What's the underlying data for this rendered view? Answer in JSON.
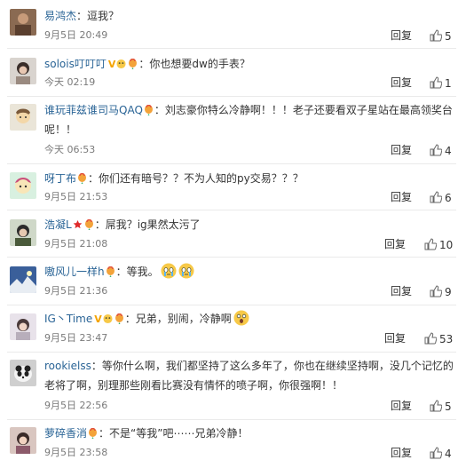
{
  "comments": [
    {
      "user": "易鸿杰",
      "sep": "：",
      "text": "逗我？",
      "time": "9月5日 20:49",
      "reply": "回复",
      "likes": "5"
    },
    {
      "user": "solois叮叮叮",
      "vip": "V",
      "sep": "：",
      "text": "你也想要dw的手表？",
      "time": "今天 02:19",
      "reply": "回复",
      "likes": "1"
    },
    {
      "user": "谁玩菲兹谁司马QAQ",
      "sep": "：",
      "text": "刘志豪你特么冷静啊！！！老子还要看双子星站在最高领奖台呢！！",
      "time": "今天 06:53",
      "reply": "回复",
      "likes": "4"
    },
    {
      "user": "呀丁布",
      "sep": "：",
      "text": "你们还有暗号？？不为人知的py交易？？？",
      "time": "9月5日 21:53",
      "reply": "回复",
      "likes": "6"
    },
    {
      "user": "浩凝L",
      "sep": "：",
      "text": "屌我？ig果然太污了",
      "time": "9月5日 21:08",
      "reply": "回复",
      "likes": "10"
    },
    {
      "user": "嗷风儿一样h",
      "sep": "：",
      "text": "等我。",
      "time": "9月5日 21:36",
      "reply": "回复",
      "likes": "9"
    },
    {
      "user": "IG丶Time",
      "vip": "V",
      "sep": "：",
      "text": "兄弟，别闹，冷静啊",
      "time": "9月5日 23:47",
      "reply": "回复",
      "likes": "53"
    },
    {
      "user": "rookielss",
      "sep": "：",
      "text": "等你什么啊，我们都坚持了这么多年了，你也在继续坚持啊，没几个记忆的老将了啊，别理那些刚看比赛没有情怀的喷子啊，你很强啊！！",
      "time": "9月5日 22:56",
      "reply": "回复",
      "likes": "5"
    },
    {
      "user": "萝碎香消",
      "sep": "：",
      "text": "不是“等我”吧⋯⋯兄弟冷静！",
      "time": "9月5日 23:58",
      "reply": "回复",
      "likes": "4"
    }
  ],
  "icons": {
    "like": "thumbs-up-icon",
    "medal": "balloon-medal-icon",
    "vip": "vip-badge-icon"
  },
  "colors": {
    "username": "#2a6496",
    "vip": "#f4a300",
    "meta": "#7a7a7a"
  }
}
